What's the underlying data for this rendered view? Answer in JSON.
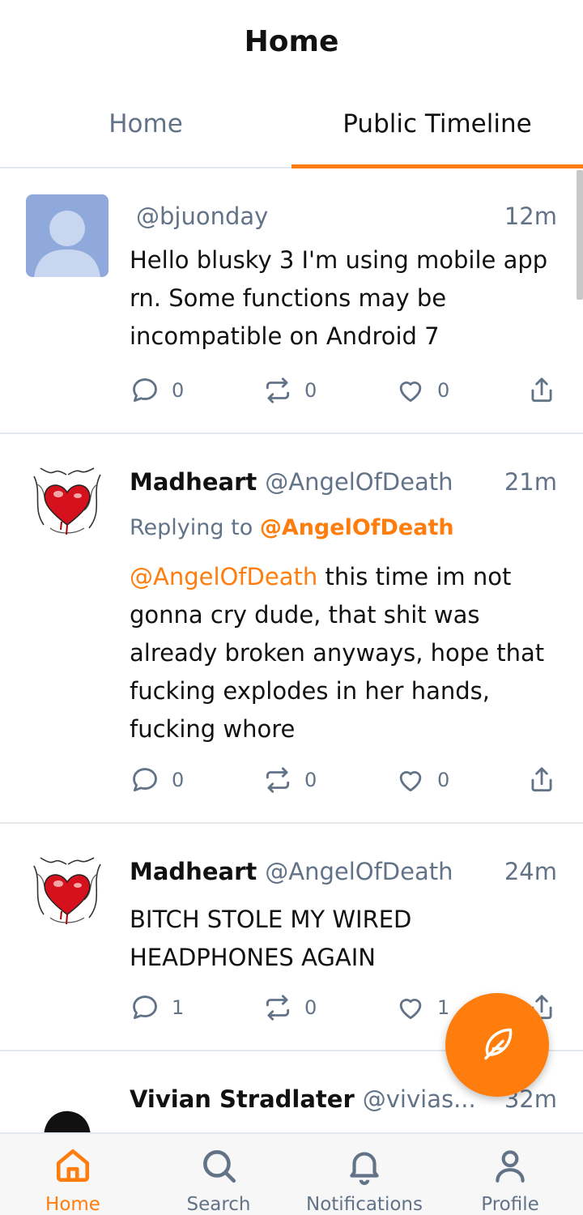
{
  "header": {
    "title": "Home"
  },
  "tabs": [
    {
      "label": "Home",
      "active": false
    },
    {
      "label": "Public Timeline",
      "active": true
    }
  ],
  "posts": [
    {
      "display_name": "",
      "handle": "@bjuonday",
      "time": "12m",
      "reply_to": null,
      "text": "Hello blusky 3 I'm using mobile app rn. Some functions may be incompatible on Android 7",
      "replies": "0",
      "reposts": "0",
      "likes": "0"
    },
    {
      "display_name": "Madheart",
      "handle": "@AngelOfDeath",
      "time": "21m",
      "reply_prefix": "Replying to",
      "reply_to": "@AngelOfDeath",
      "mention": "@AngelOfDeath",
      "text": "this time im not gonna cry dude, that shit was already broken anyways, hope that fucking explodes in her hands, fucking whore",
      "replies": "0",
      "reposts": "0",
      "likes": "0"
    },
    {
      "display_name": "Madheart",
      "handle": "@AngelOfDeath",
      "time": "24m",
      "reply_to": null,
      "text": "BITCH STOLE MY WIRED HEADPHONES AGAIN",
      "replies": "1",
      "reposts": "0",
      "likes": "1"
    },
    {
      "display_name": "Vivian Stradlater",
      "handle": "@vivias...",
      "time": "32m"
    }
  ],
  "nav": [
    {
      "label": "Home",
      "icon": "home-icon",
      "active": true
    },
    {
      "label": "Search",
      "icon": "search-icon",
      "active": false
    },
    {
      "label": "Notifications",
      "icon": "bell-icon",
      "active": false
    },
    {
      "label": "Profile",
      "icon": "person-icon",
      "active": false
    }
  ],
  "colors": {
    "accent": "#ff7d0d",
    "muted": "#627387",
    "divider": "#e3e8ee",
    "default_avatar": "#8fa9dd"
  }
}
